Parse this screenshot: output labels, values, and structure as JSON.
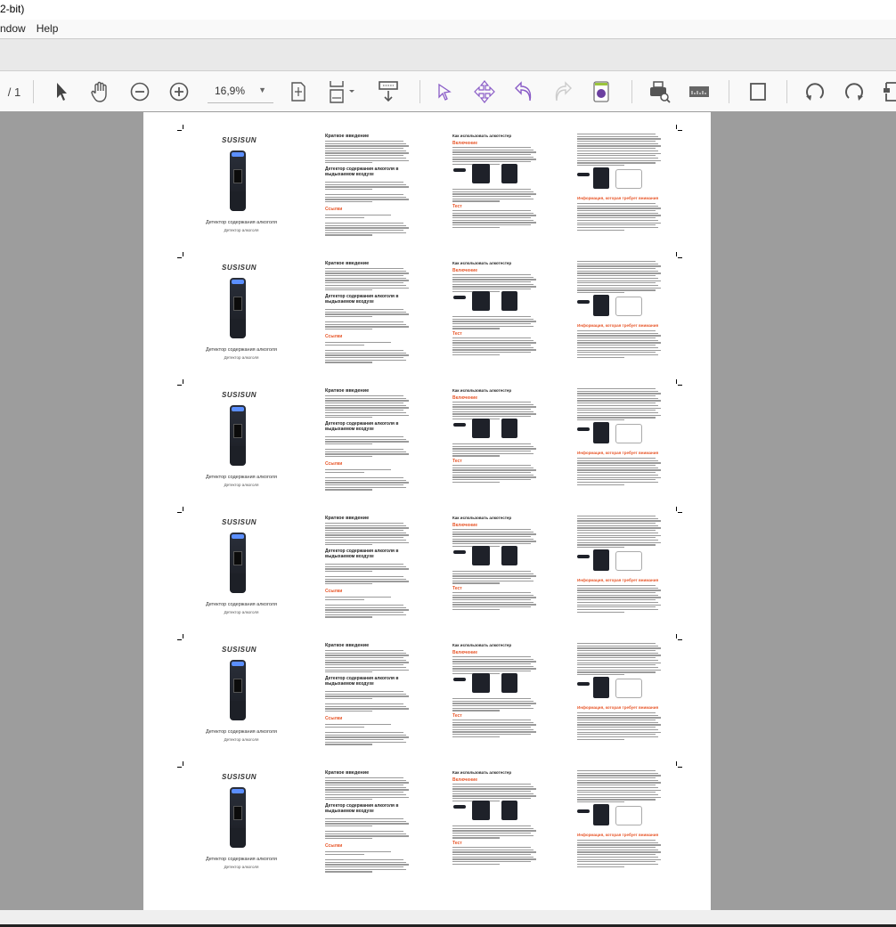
{
  "window": {
    "title_fragment": "2-bit)"
  },
  "menu": {
    "items": [
      "ndow",
      "Help"
    ]
  },
  "toolbar": {
    "page_total": "/ 1",
    "zoom_value": "16,9%",
    "icons": [
      "select-arrow-icon",
      "hand-icon",
      "zoom-out-icon",
      "zoom-in-icon",
      "fit-page-icon",
      "fit-width-icon",
      "scroll-mode-icon",
      "annotation-select-icon",
      "pan-move-icon",
      "undo-icon",
      "redo-icon",
      "3d-object-icon",
      "print-preview-icon",
      "measure-icon",
      "single-page-icon",
      "rotate-left-icon",
      "rotate-right-icon",
      "extract-page-icon"
    ]
  },
  "document": {
    "panel_repeat": 6,
    "panel": {
      "logo": "SUSISUN",
      "caption_main": "Детектор содержания алкоголя",
      "caption_sub": "Детектор алкоголя",
      "intro_heading": "Краткое введение",
      "section_heading": "Детектор содержания алкоголя в выдыхаемом воздухе",
      "links_heading": "Ссылки",
      "usage_heading": "Как использовать алкотестер",
      "power_heading": "Включение",
      "test_heading": "Тест",
      "attention_heading": "Информация, которая требует внимания"
    }
  },
  "colors": {
    "accent": "#e8572a",
    "viewer_bg": "#9d9d9d",
    "annot_purple": "#8a5cc7"
  }
}
